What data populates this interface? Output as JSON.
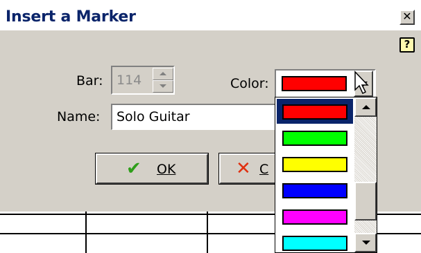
{
  "window": {
    "title": "Insert a Marker",
    "close_glyph": "✕",
    "help_glyph": "?"
  },
  "form": {
    "bar_label": "Bar:",
    "bar_value": "114",
    "color_label": "Color:",
    "color_selected": "#ff0000",
    "name_label": "Name:",
    "name_value": "Solo Guitar"
  },
  "buttons": {
    "ok_label": "OK",
    "ok_icon": "check-icon",
    "cancel_label": "C",
    "cancel_icon": "x-icon"
  },
  "color_options": [
    {
      "color": "#ff0000",
      "selected": true
    },
    {
      "color": "#00ff00",
      "selected": false
    },
    {
      "color": "#ffff00",
      "selected": false
    },
    {
      "color": "#0000ff",
      "selected": false
    },
    {
      "color": "#ff00ff",
      "selected": false
    },
    {
      "color": "#00ffff",
      "selected": false
    }
  ],
  "colors": {
    "title_text": "#0a246a",
    "dialog_face": "#d4d0c8",
    "selection_highlight": "#0a246a",
    "ok_check": "#2e9e1a",
    "cancel_x": "#e03010"
  }
}
